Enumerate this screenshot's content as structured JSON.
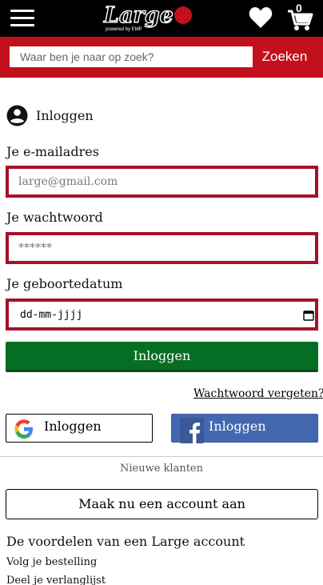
{
  "header": {
    "logo_text": "Large",
    "logo_tagline": "powered by EMP",
    "cart_count": "0",
    "icons": [
      "hamburger-menu-icon",
      "heart-icon",
      "cart-icon"
    ]
  },
  "search": {
    "placeholder": "Waar ben je naar op zoek?",
    "value": "",
    "button_label": "Zoeken"
  },
  "login": {
    "title": "Inloggen",
    "email_label": "Je e-mailadres",
    "email_placeholder": "large@gmail.com",
    "password_label": "Je wachtwoord",
    "password_placeholder": "******",
    "birthdate_label": "Je geboortedatum",
    "birthdate_value": "dd-mm-jjjj",
    "submit_label": "Inloggen",
    "forgot_label": "Wachtwoord vergeten?"
  },
  "social": {
    "google_label": "Inloggen",
    "facebook_label": "Inloggen"
  },
  "new_customers": {
    "heading": "Nieuwe klanten",
    "create_account_label": "Maak nu een account aan"
  },
  "benefits": {
    "title": "De voordelen van een Large account",
    "items": [
      "Volg je bestelling",
      "Deel je verlanglijst"
    ]
  },
  "colors": {
    "brand_red": "#c3101d",
    "field_border": "#a5112a",
    "login_green": "#066e24",
    "facebook_blue": "#4468b0",
    "header_black": "#000000"
  }
}
